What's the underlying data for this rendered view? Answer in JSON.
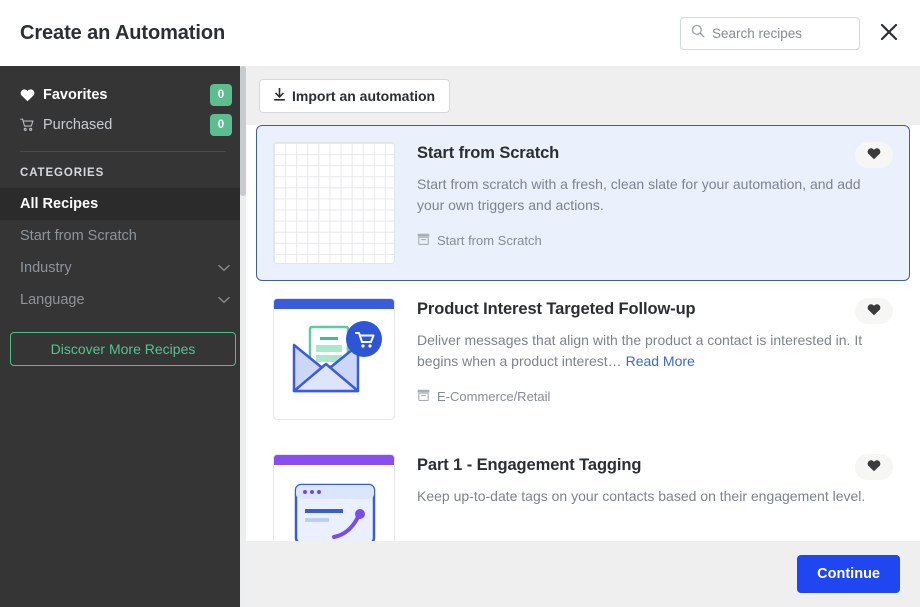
{
  "header": {
    "title": "Create an Automation",
    "search": {
      "placeholder": "Search recipes",
      "value": "",
      "icon": "search-icon"
    },
    "close_icon": "close-icon"
  },
  "sidebar": {
    "links": [
      {
        "label": "Favorites",
        "icon": "heart-icon",
        "badge": "0"
      },
      {
        "label": "Purchased",
        "icon": "cart-icon",
        "badge": "0"
      }
    ],
    "categories_heading": "CATEGORIES",
    "categories": [
      {
        "label": "All Recipes",
        "active": true,
        "expandable": false
      },
      {
        "label": "Start from Scratch",
        "active": false,
        "expandable": false
      },
      {
        "label": "Industry",
        "active": false,
        "expandable": true
      },
      {
        "label": "Language",
        "active": false,
        "expandable": true
      }
    ],
    "discover_label": "Discover More Recipes",
    "accent_green": "#5cbd8f",
    "background": "#353535"
  },
  "toolbar": {
    "import_label": "Import an automation",
    "import_icon": "download-arrow-icon"
  },
  "recipes": [
    {
      "title": "Start from Scratch",
      "description": "Start from scratch with a fresh, clean slate for your automation, and add your own triggers and actions.",
      "read_more": "",
      "tag": "Start from Scratch",
      "tag_icon": "archive-box-icon",
      "favorite_icon": "heart-icon",
      "selected": true,
      "thumb": "grid"
    },
    {
      "title": "Product Interest Targeted Follow-up",
      "description": "Deliver messages that align with the product a contact is interested in. It begins when a product interest… ",
      "read_more": "Read More",
      "tag": "E-Commerce/Retail",
      "tag_icon": "archive-box-icon",
      "favorite_icon": "heart-icon",
      "selected": false,
      "thumb": "envelope-cart"
    },
    {
      "title": "Part 1 - Engagement Tagging",
      "description": "Keep up-to-date tags on your contacts based on their engagement level.",
      "read_more": "",
      "tag": "",
      "tag_icon": "archive-box-icon",
      "favorite_icon": "heart-icon",
      "selected": false,
      "thumb": "browser-window"
    }
  ],
  "footer": {
    "continue_label": "Continue",
    "accent_blue": "#1f46f0"
  }
}
